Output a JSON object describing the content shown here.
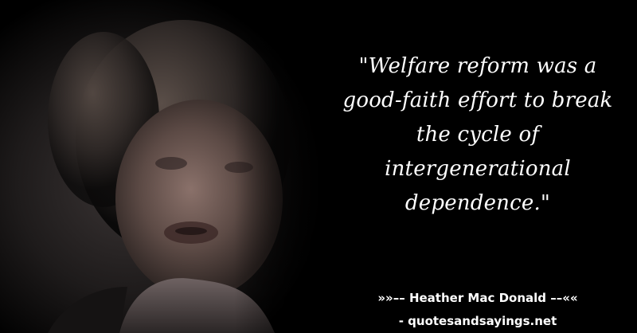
{
  "quote": {
    "text": "\"Welfare reform was a good-faith effort to break the cycle of intergenerational dependence.\""
  },
  "attribution": {
    "author_line": "»»–– Heather Mac Donald ––««",
    "source_line": "- quotesandsayings.net"
  },
  "colors": {
    "background": "#000000",
    "text": "#ffffff"
  }
}
